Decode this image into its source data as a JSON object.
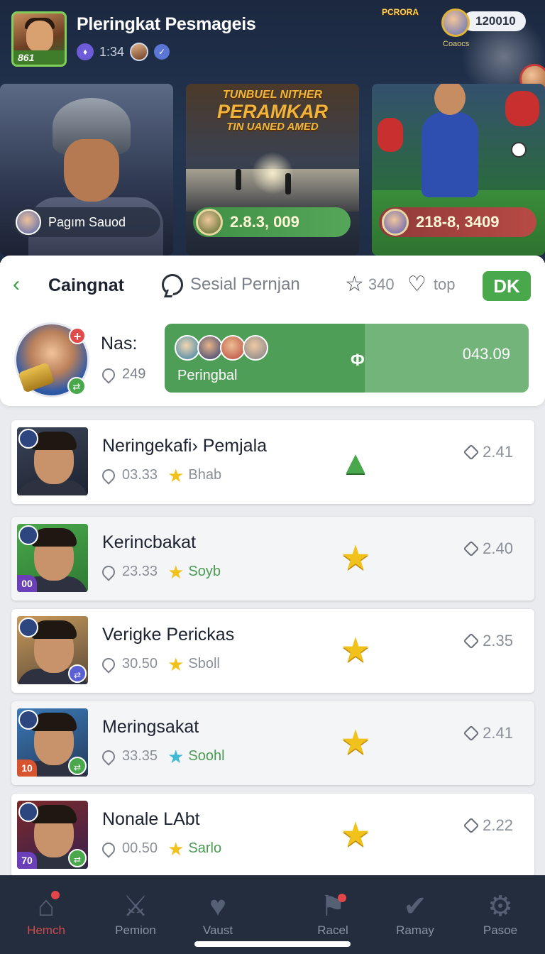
{
  "header": {
    "title": "Pleringkat Pesmageis",
    "player_level": "861",
    "time": "1:34",
    "badge_left_label": "PCRORA",
    "coins": "120010",
    "coins_label": "Coaocs"
  },
  "heroes": [
    {
      "name": "Pagım Sauod"
    },
    {
      "title_lines": [
        "TUNBUEL NITHER",
        "PERAMKAR",
        "TIN UANED AMED"
      ],
      "value": "2.8.3, 009"
    },
    {
      "value": "218-8, 3409"
    }
  ],
  "tabs": {
    "active": "Caingnat",
    "chat": "Sesial Pernjan",
    "star_count": "340",
    "heart_label": "top",
    "ok_label": "DK"
  },
  "me": {
    "name": "Nas:",
    "score": "249",
    "progress_label": "Peringbal",
    "progress_marker": "Φ",
    "progress_value": "043.09",
    "progress_fraction": 0.55
  },
  "rows": [
    {
      "name": "Neringekafi› Pemjala",
      "score": "03.33",
      "tier": "Bhab",
      "tier_style": "muted",
      "rank_icon": "envelope-up-icon",
      "rating": "2.41",
      "level": ""
    },
    {
      "name": "Kerincbakat",
      "score": "23.33",
      "tier": "Soyb",
      "tier_style": "green",
      "rank_icon": "star-icon",
      "rating": "2.40",
      "level": "00"
    },
    {
      "name": "Verigke Perickas",
      "score": "30.50",
      "tier": "Sboll",
      "tier_style": "muted",
      "rank_icon": "star-icon",
      "rating": "2.35",
      "level": ""
    },
    {
      "name": "Meringsakat",
      "score": "33.35",
      "tier": "Soohl",
      "tier_style": "green",
      "rank_icon": "star-icon",
      "rating": "2.41",
      "level": "10"
    },
    {
      "name": "Nonale LAbt",
      "score": "00.50",
      "tier": "Sarlo",
      "tier_style": "green",
      "rank_icon": "star-icon",
      "rating": "2.22",
      "level": "70"
    }
  ],
  "nav": [
    {
      "label": "Hemch",
      "icon": "home-icon"
    },
    {
      "label": "Pemion",
      "icon": "swords-icon"
    },
    {
      "label": "Vaust",
      "icon": "heart-icon"
    },
    {
      "label": "Racel",
      "icon": "flag-icon"
    },
    {
      "label": "Ramay",
      "icon": "check-circle-icon"
    },
    {
      "label": "Pasoe",
      "icon": "gear-icon"
    }
  ],
  "colors": {
    "accent_green": "#4aa84c",
    "header_bg": "#1b2840",
    "nav_bg": "#242d3e",
    "active_nav": "#d04a4a",
    "star_gold": "#f2c21c"
  }
}
